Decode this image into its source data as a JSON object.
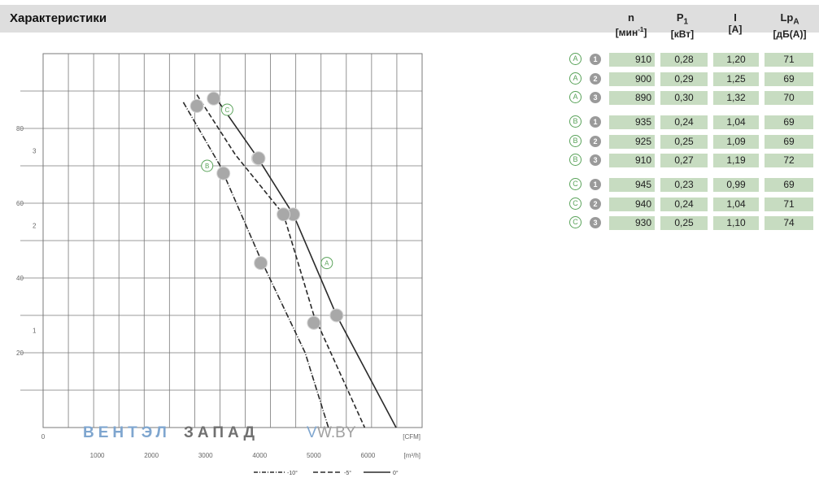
{
  "header": {
    "title": "Характеристики"
  },
  "table": {
    "columns": [
      {
        "name": "n",
        "sub": "",
        "unit_pre": "[мин",
        "unit_sup": "-1",
        "unit_post": "]"
      },
      {
        "name": "P",
        "sub": "1",
        "unit_pre": "[кВт]",
        "unit_sup": "",
        "unit_post": ""
      },
      {
        "name": "I",
        "sub": "",
        "unit_pre": "[A]",
        "unit_sup": "",
        "unit_post": ""
      },
      {
        "name": "Lp",
        "sub": "A",
        "unit_pre": "[дБ(A)]",
        "unit_sup": "",
        "unit_post": ""
      }
    ],
    "rows": [
      {
        "letter": "A",
        "num": "1",
        "n": "910",
        "p1": "0,28",
        "i": "1,20",
        "lp": "71"
      },
      {
        "letter": "A",
        "num": "2",
        "n": "900",
        "p1": "0,29",
        "i": "1,25",
        "lp": "69"
      },
      {
        "letter": "A",
        "num": "3",
        "n": "890",
        "p1": "0,30",
        "i": "1,32",
        "lp": "70"
      },
      {
        "letter": "B",
        "num": "1",
        "n": "935",
        "p1": "0,24",
        "i": "1,04",
        "lp": "69"
      },
      {
        "letter": "B",
        "num": "2",
        "n": "925",
        "p1": "0,25",
        "i": "1,09",
        "lp": "69"
      },
      {
        "letter": "B",
        "num": "3",
        "n": "910",
        "p1": "0,27",
        "i": "1,19",
        "lp": "72"
      },
      {
        "letter": "C",
        "num": "1",
        "n": "945",
        "p1": "0,23",
        "i": "0,99",
        "lp": "69"
      },
      {
        "letter": "C",
        "num": "2",
        "n": "940",
        "p1": "0,24",
        "i": "1,04",
        "lp": "71"
      },
      {
        "letter": "C",
        "num": "3",
        "n": "930",
        "p1": "0,25",
        "i": "1,10",
        "lp": "74"
      }
    ]
  },
  "watermark": {
    "part1": "ВЕНТЭЛ",
    "part2": "ЗАПАД",
    "part3": "V",
    "part4": "W.BY"
  },
  "chart_data": {
    "type": "line",
    "xlabel": "[CFM]",
    "xlabel2": "[m³/h]",
    "x_ticks": [
      "1000",
      "2000",
      "3000",
      "4000",
      "5000",
      "6000"
    ],
    "xlim": [
      0,
      7000
    ],
    "y_ticks": [
      "20",
      "40",
      "60",
      "80"
    ],
    "ylim": [
      0,
      100
    ],
    "y_ticks_inner": [
      "1",
      "2",
      "3"
    ],
    "grid": true,
    "series": [
      {
        "name": "0°",
        "dash": "solid",
        "x": [
          3150,
          3970,
          4620,
          5420,
          6520
        ],
        "y": [
          89,
          72,
          57,
          30,
          0
        ]
      },
      {
        "name": "-5°",
        "dash": "dashed",
        "x": [
          2840,
          3550,
          4440,
          5000,
          5940
        ],
        "y": [
          89,
          73,
          57,
          30,
          0
        ]
      },
      {
        "name": "-10°",
        "dash": "dashdot",
        "x": [
          2590,
          3270,
          4020,
          4840,
          5270
        ],
        "y": [
          87,
          70,
          45,
          20,
          0
        ]
      }
    ],
    "points": [
      {
        "series": "0°",
        "x": 3150,
        "y": 88
      },
      {
        "series": "0°",
        "x": 3970,
        "y": 72
      },
      {
        "series": "0°",
        "x": 4620,
        "y": 57
      },
      {
        "series": "0°",
        "x": 5420,
        "y": 30
      },
      {
        "series": "-5°",
        "x": 2840,
        "y": 86
      },
      {
        "series": "-5°",
        "x": 3980,
        "y": 72
      },
      {
        "series": "-5°",
        "x": 4440,
        "y": 57
      },
      {
        "series": "-5°",
        "x": 5000,
        "y": 28
      },
      {
        "series": "-10°",
        "x": 3330,
        "y": 68
      },
      {
        "series": "-10°",
        "x": 4020,
        "y": 44
      }
    ],
    "curve_labels": [
      {
        "text": "A",
        "x": 5240,
        "y": 44
      },
      {
        "text": "B",
        "x": 3030,
        "y": 70
      },
      {
        "text": "C",
        "x": 3400,
        "y": 85
      }
    ],
    "colors": {
      "grid": "#7a7a7a",
      "curve": "#2a2a2a",
      "point": "#a8a8a8",
      "label": "#5aa35a"
    }
  }
}
